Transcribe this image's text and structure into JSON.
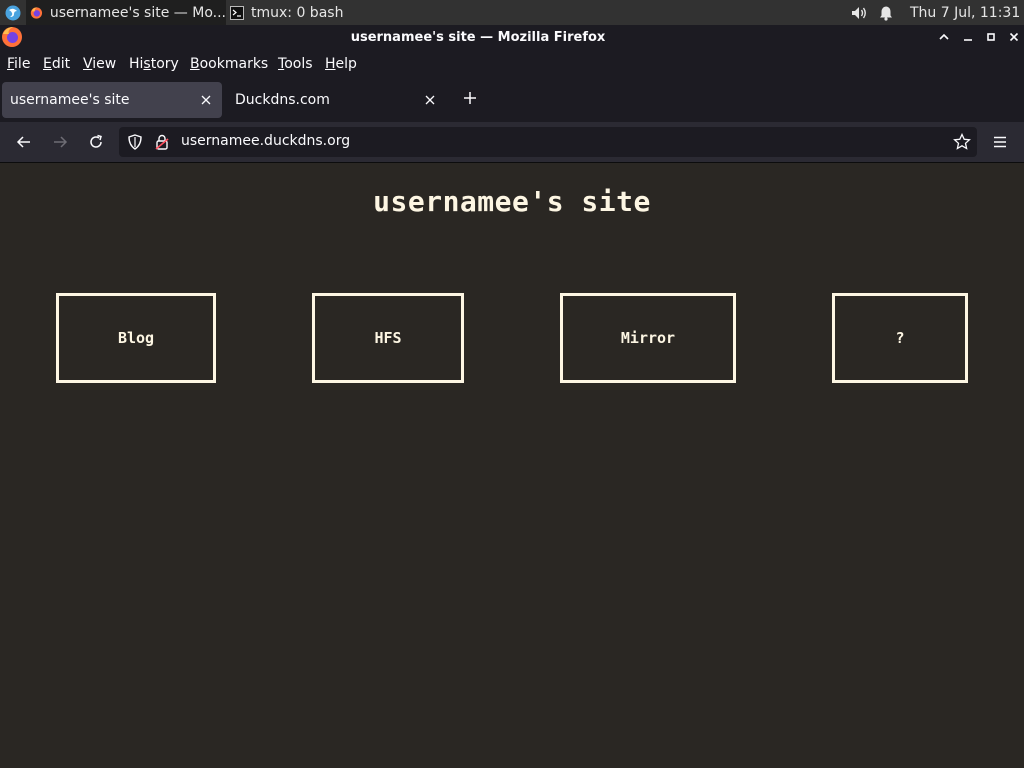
{
  "taskbar": {
    "firefox_task": "usernamee's site — Mo...",
    "terminal_task": "tmux: 0 bash",
    "clock": "Thu  7 Jul, 11:31"
  },
  "window": {
    "title": "usernamee's site — Mozilla Firefox"
  },
  "menubar": {
    "items": [
      {
        "first": "F",
        "rest": "ile"
      },
      {
        "first": "E",
        "rest": "dit"
      },
      {
        "first": "V",
        "rest": "iew"
      },
      {
        "first": "",
        "pre": "Hi",
        "ul": "s",
        "post": "tory"
      },
      {
        "first": "B",
        "rest": "ookmarks"
      },
      {
        "first": "T",
        "rest": "ools"
      },
      {
        "first": "H",
        "rest": "elp"
      }
    ]
  },
  "tabs": [
    {
      "label": "usernamee's site",
      "active": true
    },
    {
      "label": "Duckdns.com",
      "active": false
    }
  ],
  "navbar": {
    "url": "usernamee.duckdns.org"
  },
  "page": {
    "title": "usernamee's site",
    "links": [
      "Blog",
      "HFS",
      "Mirror",
      "?"
    ]
  },
  "colors": {
    "page_bg": "#2a2723",
    "page_fg": "#fdf6e3",
    "chrome_bg": "#1c1b22",
    "active_tab": "#42414d"
  },
  "icons": {
    "launcher": "distro-logo-icon",
    "browser": "firefox-icon",
    "terminal": "terminal-icon",
    "volume": "volume-icon",
    "notifications": "bell-icon"
  }
}
